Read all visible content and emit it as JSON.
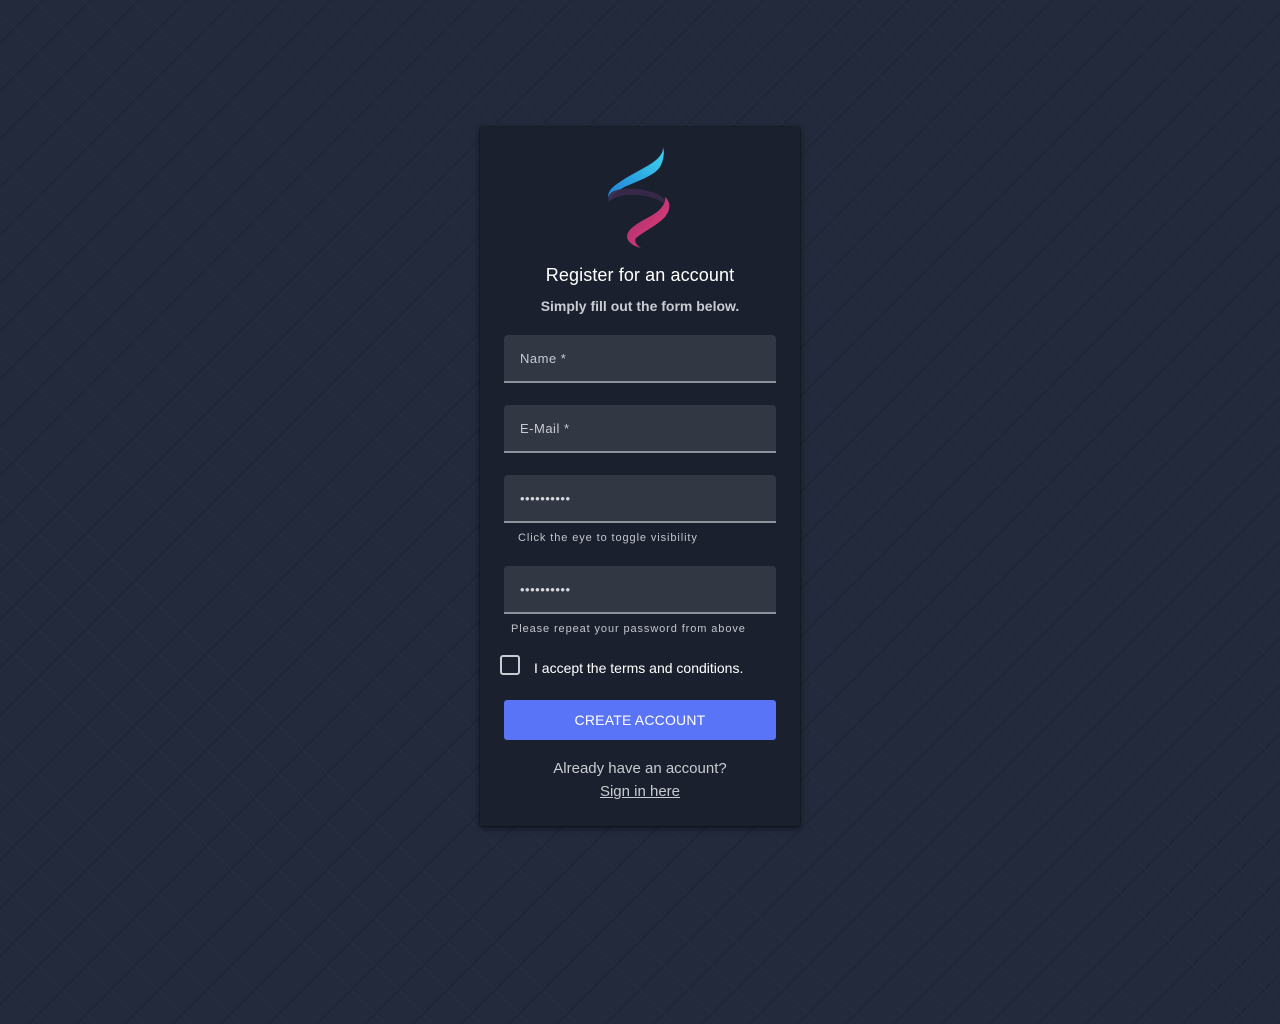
{
  "header": {
    "logo": "flame-logo-icon",
    "title": "Register for an account",
    "subtitle": "Simply fill out the form below."
  },
  "form": {
    "name_placeholder": "Name *",
    "email_placeholder": "E-Mail *",
    "password_value": "••••••••••",
    "password_hint": "Click the eye to toggle visibility",
    "repeat_value": "••••••••••",
    "repeat_hint": "Please repeat your password from above",
    "terms_label": "I accept the terms and conditions.",
    "terms_checked": false,
    "submit_label": "CREATE ACCOUNT"
  },
  "footer": {
    "prompt": "Already have an account?",
    "signin_link": "Sign in here"
  },
  "colors": {
    "page_background": "#222a3c",
    "card_background": "#1b202e",
    "field_background": "#323744",
    "accent": "#5a74f8",
    "logo_blue": "#27b6e8",
    "logo_pink": "#ee3f7d"
  }
}
